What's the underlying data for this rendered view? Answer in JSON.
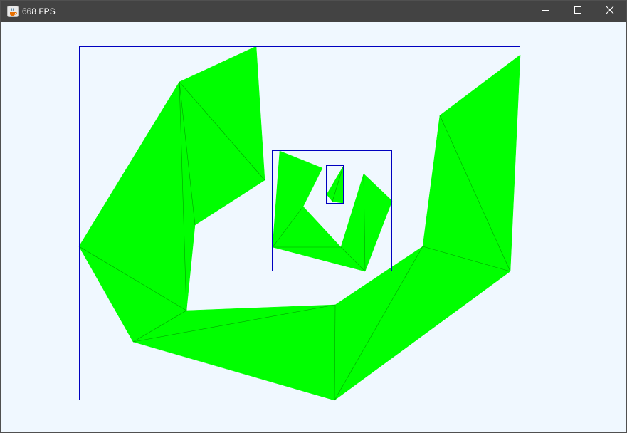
{
  "window": {
    "title": "668 FPS",
    "icon": "java-cup-icon",
    "controls": {
      "minimize": "minimize-icon",
      "maximize": "maximize-icon",
      "close": "close-icon"
    }
  },
  "scene": {
    "background_color": "#f0f8ff",
    "fill_color": "#00ff00",
    "edge_color": "#00a000",
    "bounds_color": "#0000c0"
  }
}
